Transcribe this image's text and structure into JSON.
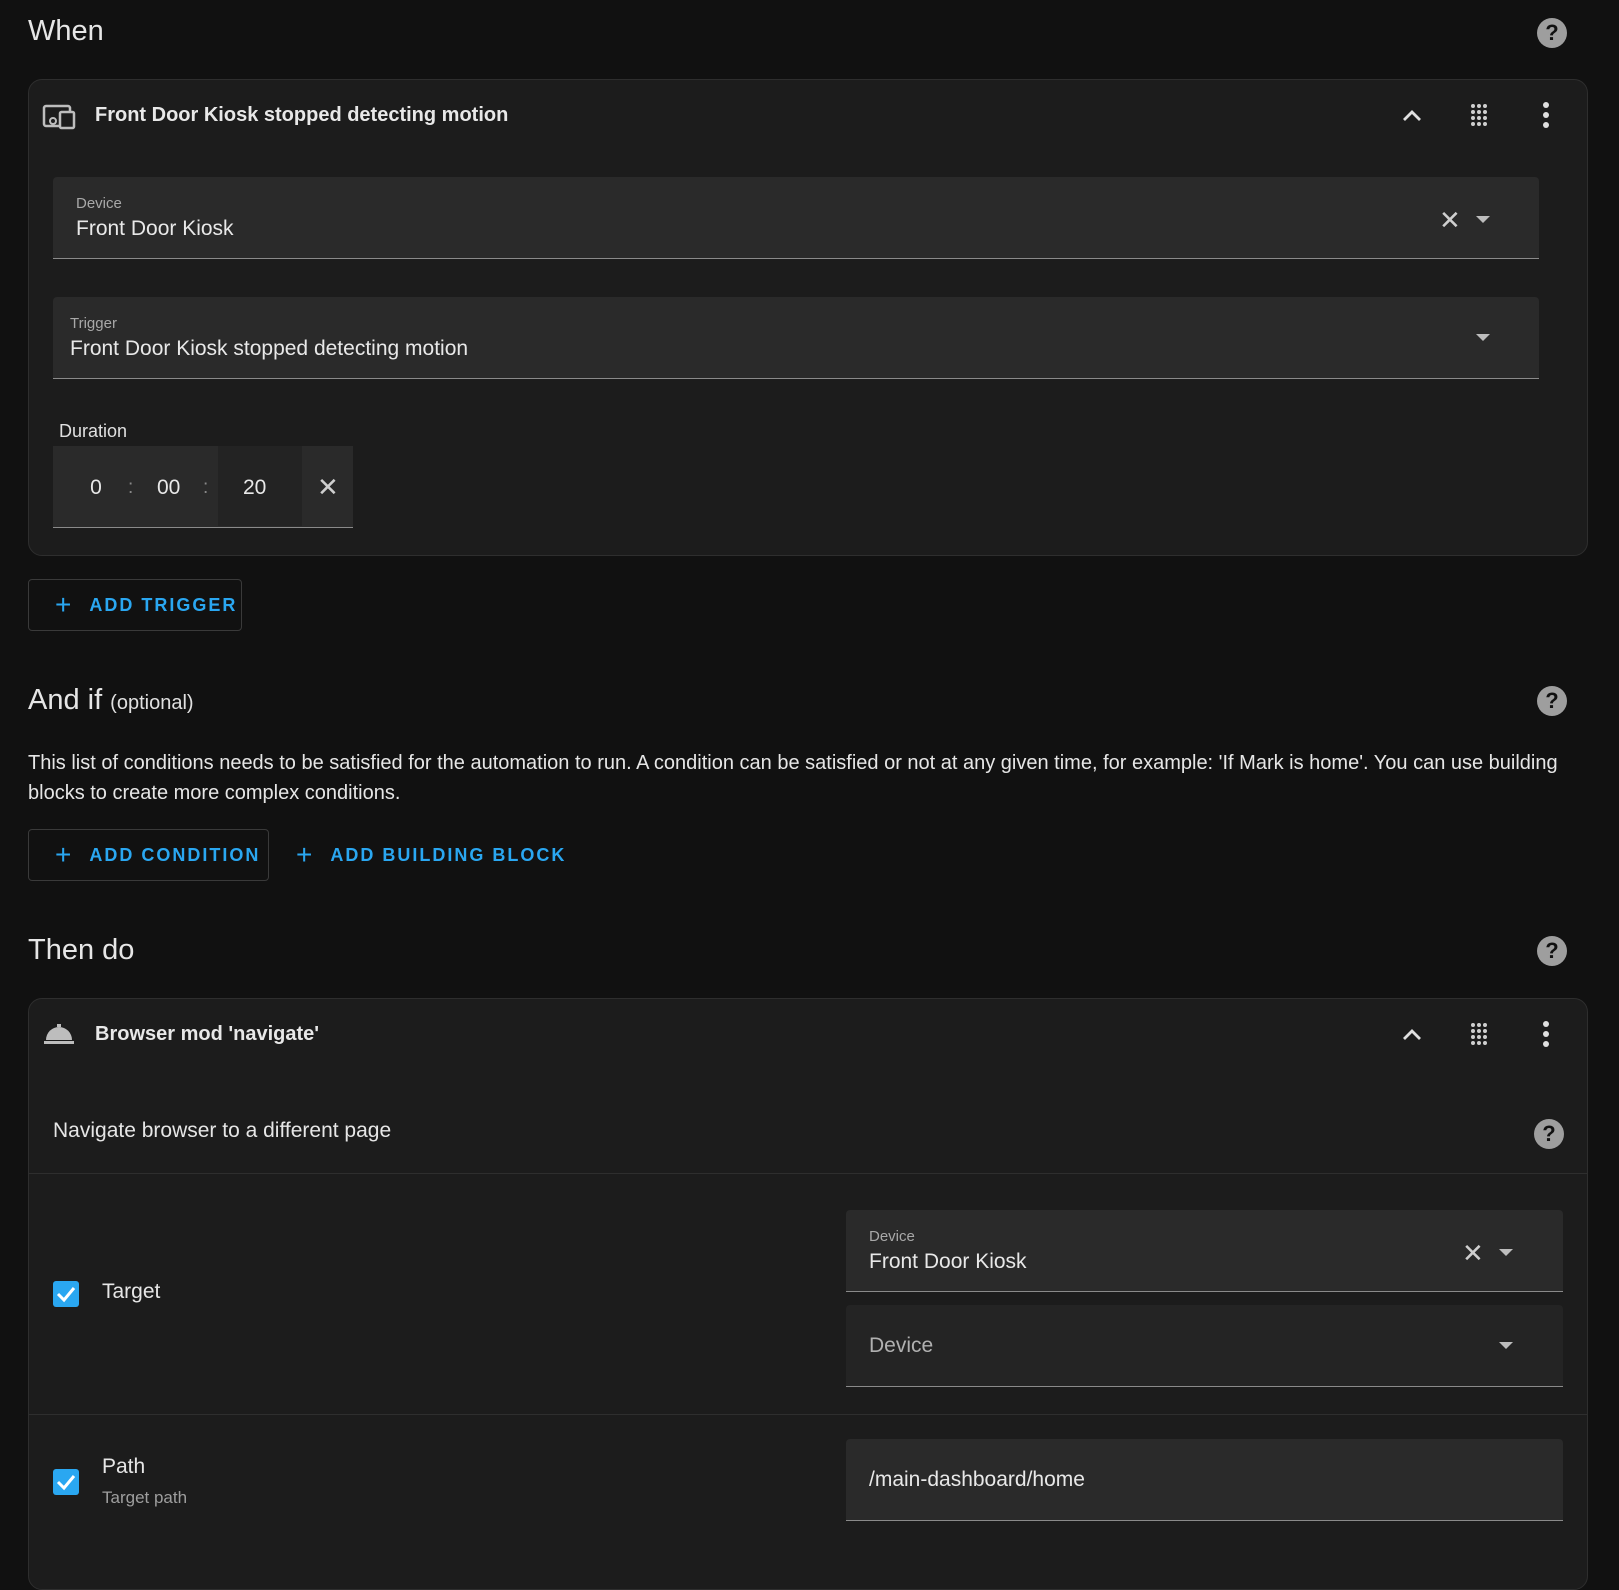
{
  "when": {
    "title": "When",
    "trigger_card": {
      "title": "Front Door Kiosk stopped detecting motion",
      "device_field": {
        "label": "Device",
        "value": "Front Door Kiosk"
      },
      "trigger_field": {
        "label": "Trigger",
        "value": "Front Door Kiosk stopped detecting motion"
      },
      "duration": {
        "label": "Duration",
        "hours": "0",
        "minutes": "00",
        "seconds": "20",
        "sep": ":"
      }
    },
    "add_trigger_label": "ADD TRIGGER"
  },
  "and_if": {
    "title": "And if",
    "optional": "(optional)",
    "description": "This list of conditions needs to be satisfied for the automation to run. A condition can be satisfied or not at any given time, for example: 'If Mark is home'. You can use building blocks to create more complex conditions.",
    "add_condition_label": "ADD CONDITION",
    "add_building_block_label": "ADD BUILDING BLOCK"
  },
  "then_do": {
    "title": "Then do",
    "action_card": {
      "title": "Browser mod 'navigate'",
      "description": "Navigate browser to a different page",
      "target": {
        "label": "Target",
        "checked": true,
        "device_field": {
          "label": "Device",
          "value": "Front Door Kiosk"
        },
        "device_placeholder": "Device"
      },
      "path": {
        "label": "Path",
        "sublabel": "Target path",
        "checked": true,
        "value": "/main-dashboard/home"
      }
    }
  },
  "icons": {
    "help": "?",
    "check": "✓",
    "clear": "✕",
    "plus": "+",
    "collapse": "chevron-up-icon",
    "drag": "drag-grid-icon",
    "more": "dots-vertical-icon"
  },
  "colors": {
    "accent": "#2aa7f1",
    "background": "#111111",
    "card": "#1c1c1c",
    "field": "#2a2a2a"
  }
}
